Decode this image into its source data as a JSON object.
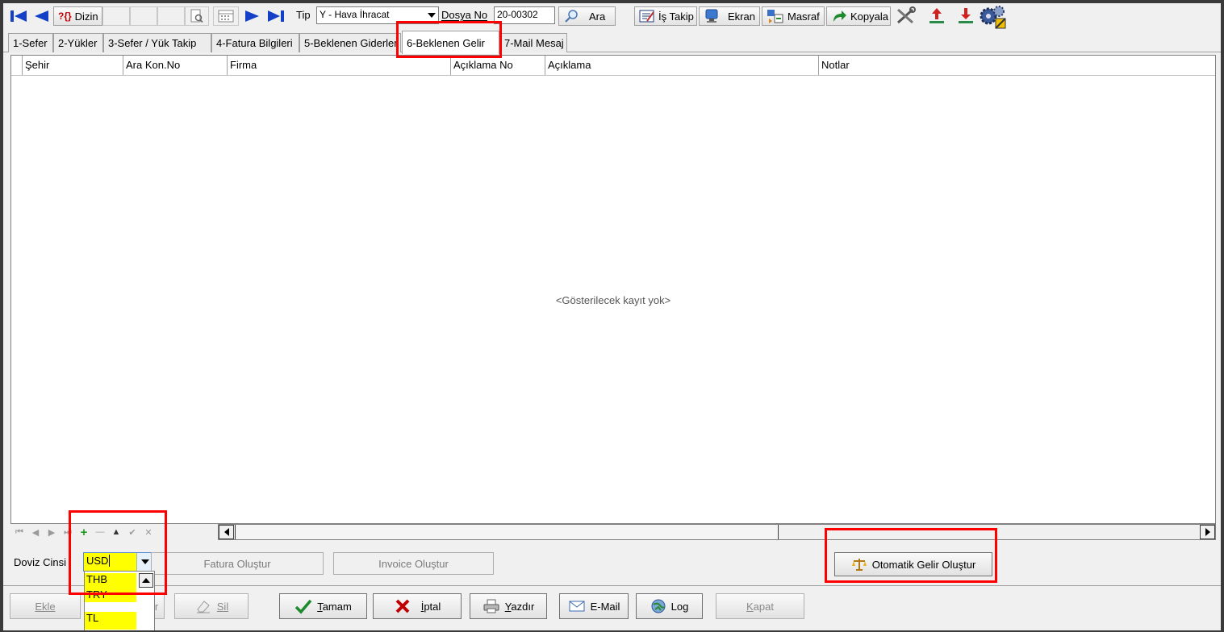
{
  "toolbar": {
    "dizin_label": "Dizin",
    "help_glyph": "?{}",
    "tip_label": "Tip",
    "tip_value": "Y - Hava İhracat",
    "dosya_label": "Dosya No",
    "dosya_value": "20-00302",
    "ara_label": "Ara",
    "is_takip_label": "İş Takip",
    "ekran_label": "Ekran",
    "masraf_label": "Masraf",
    "kopyala_label": "Kopyala"
  },
  "tabs": [
    {
      "label": "1-Sefer"
    },
    {
      "label": "2-Yükler"
    },
    {
      "label": "3-Sefer / Yük Takip"
    },
    {
      "label": "4-Fatura Bilgileri"
    },
    {
      "label": "5-Beklenen Giderler"
    },
    {
      "label": "6-Beklenen Gelir"
    },
    {
      "label": "7-Mail Mesaj"
    }
  ],
  "grid": {
    "columns": [
      "Şehir",
      "Ara Kon.No",
      "Firma",
      "Açıklama No",
      "Açıklama",
      "Notlar"
    ],
    "empty_text": "<Gösterilecek kayıt yok>"
  },
  "currency": {
    "label": "Doviz Cinsi",
    "value": "USD",
    "options": [
      "THB",
      "TRY",
      "TL"
    ]
  },
  "actions": {
    "fatura_label": "Fatura Oluştur",
    "invoice_label": "Invoice Oluştur",
    "otomatik_label": "Otomatik Gelir Oluştur"
  },
  "footer": {
    "ekle_label": "Ekle",
    "degistir_tail": "ir",
    "sil_label": "Sil",
    "tamam_key": "T",
    "tamam_rest": "amam",
    "iptal_key": "İ",
    "iptal_rest": "ptal",
    "yazdir_key": "Y",
    "yazdir_rest": "azdır",
    "email_label": "E-Mail",
    "log_label": "Log",
    "kapat_key": "K",
    "kapat_rest": "apat"
  }
}
